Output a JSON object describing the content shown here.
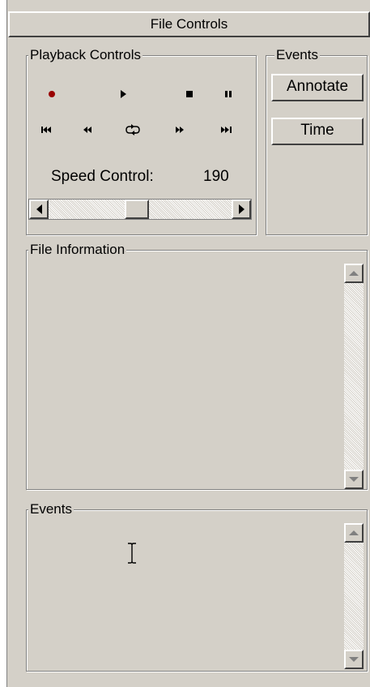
{
  "panel": {
    "title": "File Controls"
  },
  "playback": {
    "label": "Playback Controls",
    "speed_label": "Speed Control:",
    "speed_value": "190",
    "slider_fraction": 0.48,
    "record_color": "#990000"
  },
  "events_box": {
    "label": "Events",
    "annotate_label": "Annotate",
    "time_label": "Time"
  },
  "file_info": {
    "label": "File Information",
    "content": ""
  },
  "events_log": {
    "label": "Events",
    "content": ""
  }
}
